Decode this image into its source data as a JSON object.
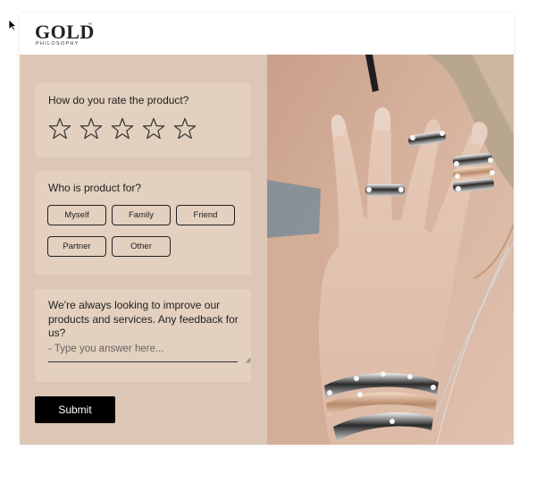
{
  "brand": {
    "logo_main": "GOLD",
    "logo_tm": "™",
    "logo_sub": "PHILOSOPHY"
  },
  "rating": {
    "question": "How do you rate the product?",
    "stars_total": 5,
    "stars_selected": 0
  },
  "recipient": {
    "question": "Who is product for?",
    "options": [
      "Myself",
      "Family",
      "Friend",
      "Partner",
      "Other"
    ]
  },
  "feedback": {
    "question": "We're always looking to improve our products and services. Any feedback for us?",
    "placeholder": "- Type you answer here...",
    "value": ""
  },
  "submit_label": "Submit",
  "colors": {
    "panel_bg": "#dcc7b6",
    "panel_card": "#e3d0bf",
    "button_bg": "#000000"
  }
}
